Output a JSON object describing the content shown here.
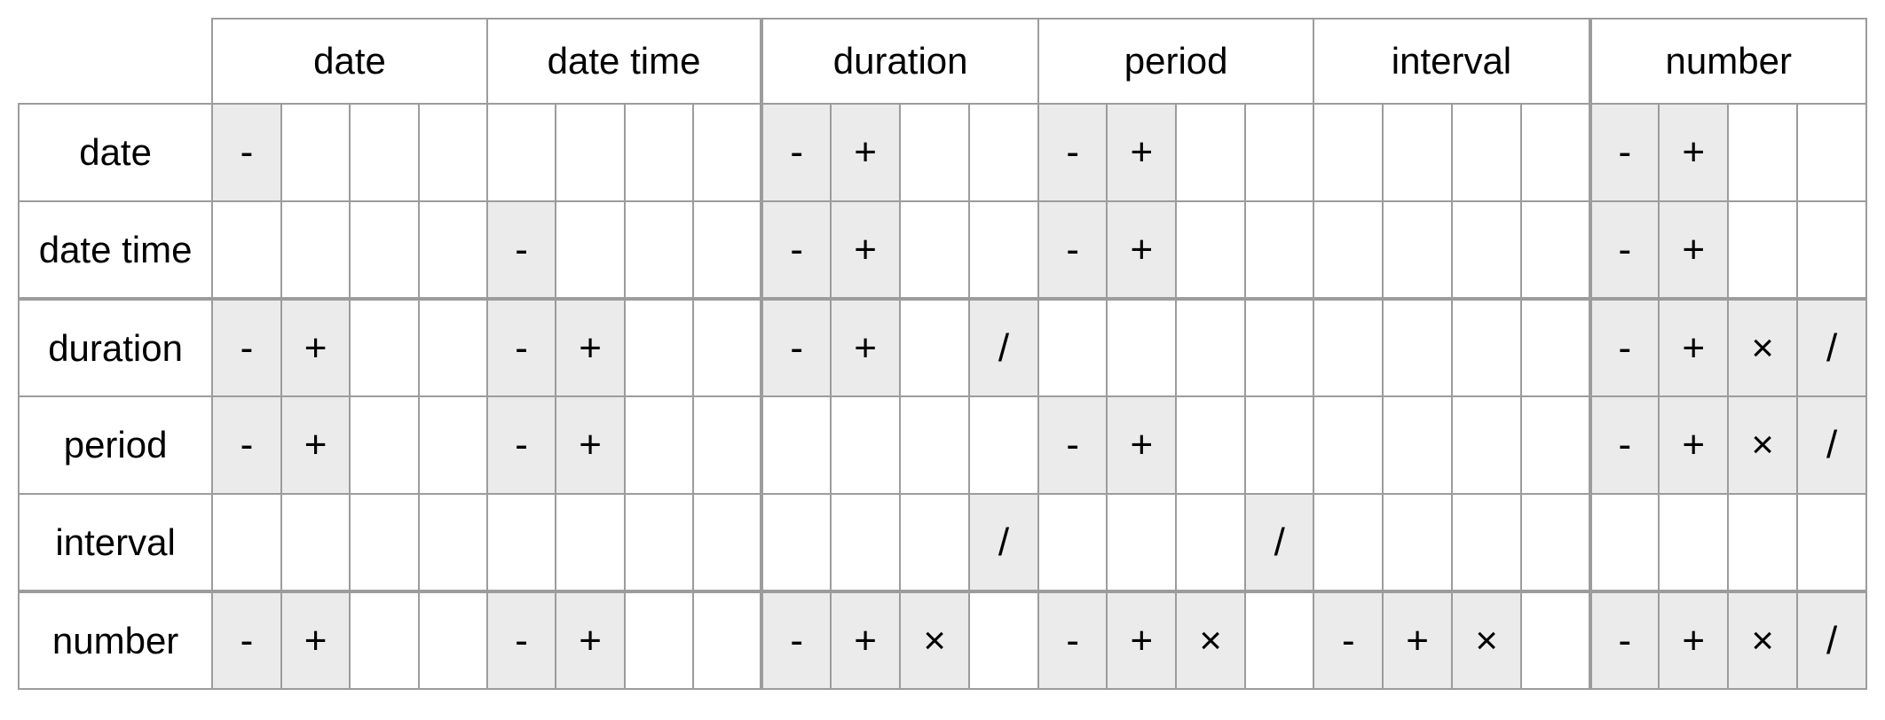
{
  "types": [
    "date",
    "date time",
    "duration",
    "period",
    "interval",
    "number"
  ],
  "operator_slots": [
    "-",
    "+",
    "×",
    "/"
  ],
  "group_separators_after_index": [
    1,
    4
  ],
  "matrix": [
    [
      [
        "-",
        "",
        "",
        ""
      ],
      [
        "",
        "",
        "",
        ""
      ],
      [
        "-",
        "+",
        "",
        ""
      ],
      [
        "-",
        "+",
        "",
        ""
      ],
      [
        "",
        "",
        "",
        ""
      ],
      [
        "-",
        "+",
        "",
        ""
      ]
    ],
    [
      [
        "",
        "",
        "",
        ""
      ],
      [
        "-",
        "",
        "",
        ""
      ],
      [
        "-",
        "+",
        "",
        ""
      ],
      [
        "-",
        "+",
        "",
        ""
      ],
      [
        "",
        "",
        "",
        ""
      ],
      [
        "-",
        "+",
        "",
        ""
      ]
    ],
    [
      [
        "-",
        "+",
        "",
        ""
      ],
      [
        "-",
        "+",
        "",
        ""
      ],
      [
        "-",
        "+",
        "",
        "/"
      ],
      [
        "",
        "",
        "",
        ""
      ],
      [
        "",
        "",
        "",
        ""
      ],
      [
        "-",
        "+",
        "×",
        "/"
      ]
    ],
    [
      [
        "-",
        "+",
        "",
        ""
      ],
      [
        "-",
        "+",
        "",
        ""
      ],
      [
        "",
        "",
        "",
        ""
      ],
      [
        "-",
        "+",
        "",
        ""
      ],
      [
        "",
        "",
        "",
        ""
      ],
      [
        "-",
        "+",
        "×",
        "/"
      ]
    ],
    [
      [
        "",
        "",
        "",
        ""
      ],
      [
        "",
        "",
        "",
        ""
      ],
      [
        "",
        "",
        "",
        "/"
      ],
      [
        "",
        "",
        "",
        "/"
      ],
      [
        "",
        "",
        "",
        ""
      ],
      [
        "",
        "",
        "",
        ""
      ]
    ],
    [
      [
        "-",
        "+",
        "",
        ""
      ],
      [
        "-",
        "+",
        "",
        ""
      ],
      [
        "-",
        "+",
        "×",
        ""
      ],
      [
        "-",
        "+",
        "×",
        ""
      ],
      [
        "-",
        "+",
        "×",
        ""
      ],
      [
        "-",
        "+",
        "×",
        "/"
      ]
    ]
  ]
}
